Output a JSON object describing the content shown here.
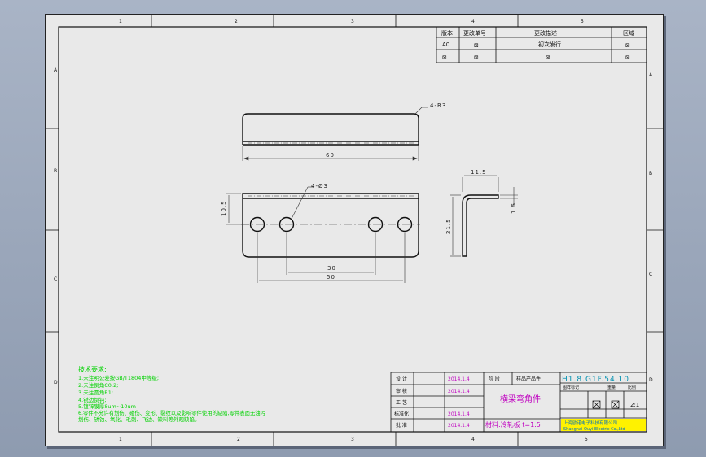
{
  "border": {
    "top_zones": [
      "1",
      "2",
      "3",
      "4",
      "5"
    ],
    "bottom_zones": [
      "1",
      "2",
      "3",
      "4",
      "5"
    ],
    "left_zones": [
      "A",
      "B",
      "C",
      "D"
    ],
    "right_zones": [
      "A",
      "B",
      "C",
      "D"
    ]
  },
  "revision_table": {
    "headers": [
      "版本",
      "更改单号",
      "更改描述",
      "区域"
    ],
    "rows": [
      [
        "A0",
        "⊠",
        "初次发行",
        "⊠"
      ],
      [
        "⊠",
        "⊠",
        "⊠",
        "⊠"
      ]
    ]
  },
  "dimensions": {
    "top_view_note": "4-R3",
    "top_view_width": "60",
    "front_holes": "4-Ø3",
    "front_height": "10.5",
    "front_hole_spacing_inner": "30",
    "front_hole_spacing_outer": "50",
    "side_width": "11.5",
    "side_height": "21.5",
    "side_thickness": "1.5"
  },
  "tech_requirements": {
    "title": "技术要求:",
    "lines": [
      "1.未注明公差按GB/T1804中等级;",
      "2.未注倒角C0.2;",
      "3.未注圆角R1;",
      "4.锐边倒钝;",
      "5.镀锌膜厚8um~10um",
      "6.零件不允许有划伤、碰伤、变形、裂纹以及影响零件使用的缺陷,零件表面无油污",
      "划伤、锈蚀、氧化、毛刺、飞边、缺料等外观缺陷。"
    ]
  },
  "title_block": {
    "labels": [
      "设 计",
      "审 核",
      "工 艺",
      "标准化",
      "批 准"
    ],
    "dates": [
      "2014.1.4",
      "2014.1.4",
      "",
      "2014.1.4",
      "2014.1.4"
    ],
    "stage_label": "阶 段",
    "stage_value": "样品产品件",
    "part_name": "横梁弯角件",
    "material": "材料:冷轧板 t=1.5",
    "drawing_number": "H1.8.G1F.54.10",
    "mini_headers": [
      "图样标记",
      "重量",
      "比例"
    ],
    "scale": "2:1",
    "company_cn": "上海欧诺电子科技有限公司",
    "company_en": "Shanghai Ouyi Electric Co.,Ltd"
  }
}
